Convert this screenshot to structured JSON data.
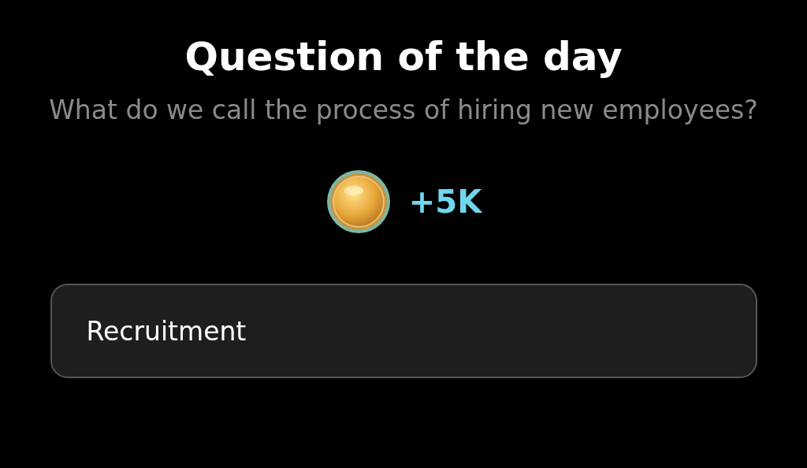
{
  "title": "Question of the day",
  "question": "What do we call the process of hiring new employees?",
  "reward": {
    "amount": "+5K"
  },
  "answer": {
    "value": "Recruitment"
  }
}
